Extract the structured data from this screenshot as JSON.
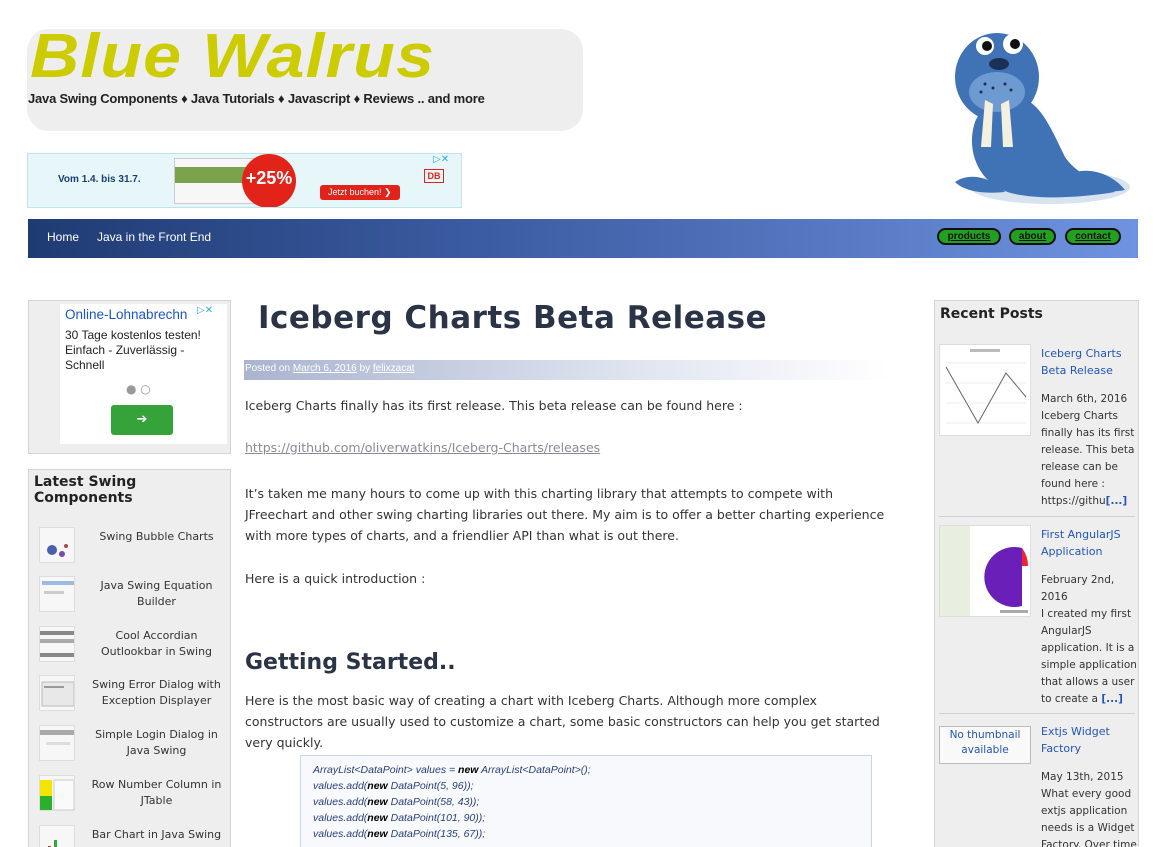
{
  "header": {
    "title": "Blue Walrus",
    "tagline": "Java Swing Components ♦ Java Tutorials ♦ Javascript ♦ Reviews .. and more"
  },
  "top_ad": {
    "date_text": "Vom 1.4. bis 31.7.",
    "discount": "+25%",
    "cta": "Jetzt buchen! ❯",
    "brand": "DB"
  },
  "nav": {
    "home": "Home",
    "java_front_end": "Java in the Front End",
    "pills": [
      "products",
      "about",
      "contact"
    ]
  },
  "left_ad": {
    "headline": "Online-Lohnabrechn",
    "body": "30 Tage kostenlos testen! Einfach - Zuverlässig - Schnell",
    "dots": "● ○",
    "arrow": "➔"
  },
  "latest": {
    "heading": "Latest Swing Components",
    "items": [
      "Swing Bubble Charts",
      "Java Swing Equation Builder",
      "Cool Accordian Outlookbar in Swing",
      "Swing Error Dialog with Exception Displayer",
      "Simple Login Dialog in Java Swing",
      "Row Number Column in JTable",
      "Bar Chart in Java Swing"
    ]
  },
  "post": {
    "title": "Iceberg Charts Beta Release",
    "meta_posted": "Posted on ",
    "meta_date": "March 6, 2016",
    "meta_by": " by ",
    "meta_author": "felixzacat",
    "p1": "Iceberg Charts finally has its first release. This beta release can be found here :",
    "url": "https://github.com/oliverwatkins/Iceberg-Charts/releases",
    "p2": "It’s taken me many hours to come up with this charting library that attempts to compete with JFreechart and other swing charting libraries out there. My aim is to offer a better charting experience with more types of charts, and a friendlier API than what is out there.",
    "p3": "Here is a  quick introduction :",
    "h2": "Getting Started..",
    "p4": "Here is the most basic way of creating a chart with Iceberg Charts. Although more complex constructors are usually used to customize a chart, some basic constructors can help you get started very quickly."
  },
  "code": {
    "line1_a": "ArrayList<DataPoint> values = ",
    "kw_new": "new",
    "line1_b": " ArrayList<DataPoint>();",
    "add_prefix": "values.add(",
    "add_lines": [
      " DataPoint(5, 96));",
      " DataPoint(58, 43));",
      " DataPoint(101, 90));",
      " DataPoint(135, 67));"
    ]
  },
  "recent": {
    "heading": "Recent Posts",
    "posts": [
      {
        "title": "Iceberg Charts Beta Release",
        "date": "March 6th, 2016",
        "excerpt": "Iceberg Charts finally has its first release. This beta release can be found here : https://githu",
        "more": "[...]"
      },
      {
        "title": "First AngularJS Application",
        "date": "February 2nd, 2016",
        "excerpt": "I created my first AngularJS application. It is a simple application that allows a user to create a ",
        "more": "[...]"
      },
      {
        "title": "Extjs Widget Factory",
        "date": "May 13th, 2015",
        "excerpt": "What every good extjs application needs is a Widget Factory. Over time"
      }
    ],
    "no_thumb": "No thumbnail available"
  }
}
